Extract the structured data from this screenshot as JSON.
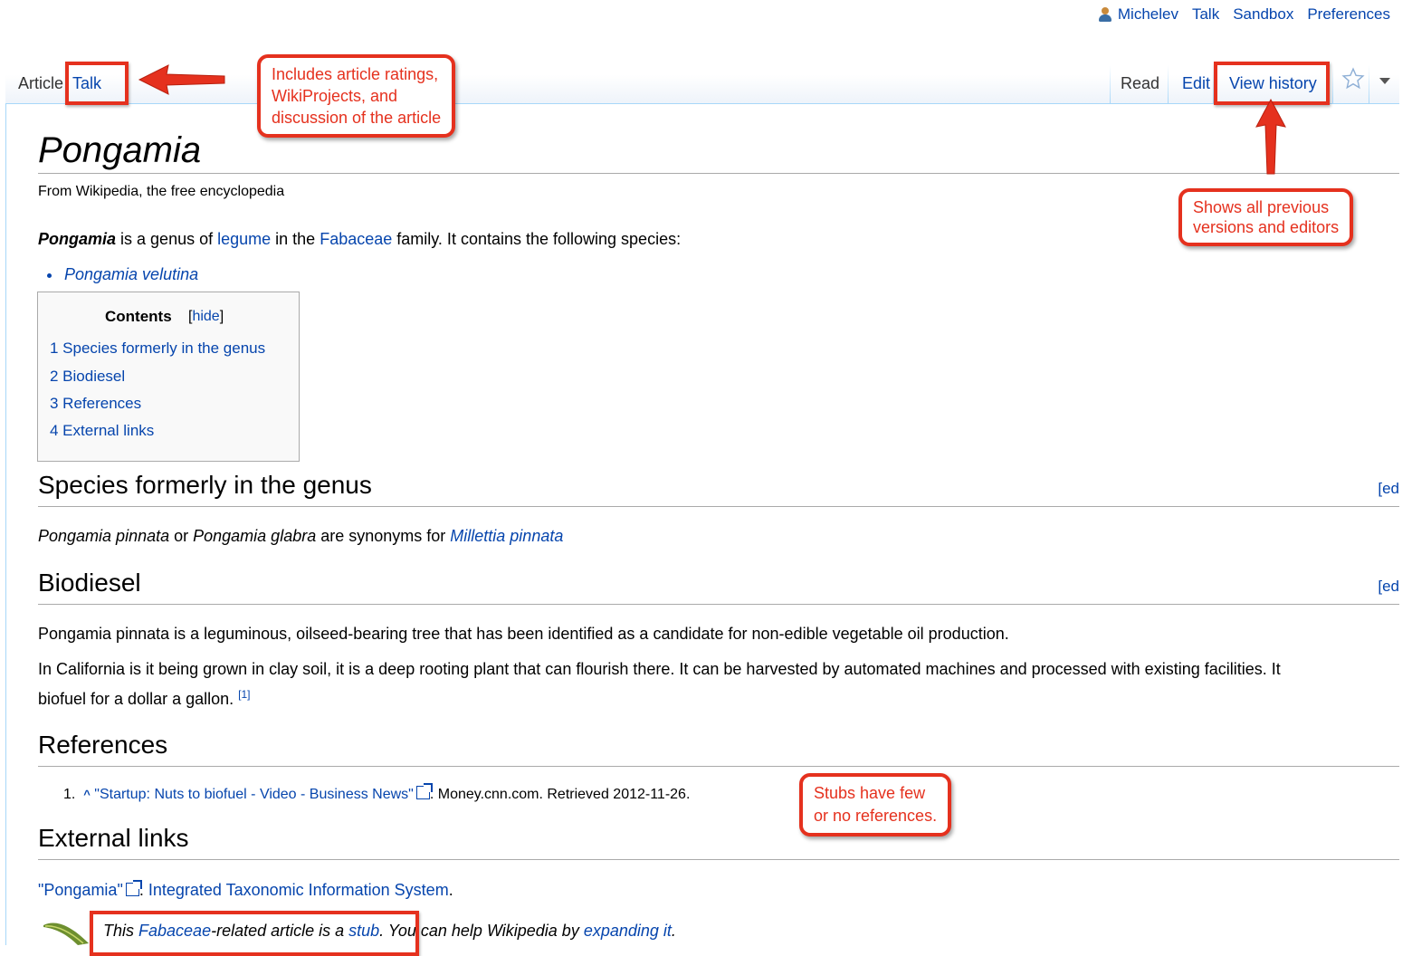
{
  "personal": {
    "username": "Michelev",
    "talk": "Talk",
    "sandbox": "Sandbox",
    "preferences": "Preferences",
    "user_icon": "user-icon"
  },
  "tabs": {
    "article": "Article",
    "talk": "Talk",
    "read": "Read",
    "edit": "Edit",
    "view_history": "View history",
    "watch_icon": "star-icon",
    "more_icon": "chevron-down-icon"
  },
  "page": {
    "title": "Pongamia",
    "tagline": "From Wikipedia, the free encyclopedia",
    "intro": {
      "bold": "Pongamia",
      "t1": " is a genus of ",
      "legume": "legume",
      "t2": " in the ",
      "fabaceae": "Fabaceae",
      "t3": " family. It contains the following species:"
    },
    "species": "Pongamia velutina"
  },
  "toc": {
    "title": "Contents",
    "hide_open": "[",
    "hide": "hide",
    "hide_close": "]",
    "items": [
      "1 Species formerly in the genus",
      "2 Biodiesel",
      "3 References",
      "4 External links"
    ]
  },
  "sections": {
    "species": {
      "heading": "Species formerly in the genus",
      "edit": "[ed",
      "p_a": "Pongamia pinnata",
      "p_b": " or ",
      "p_c": "Pongamia glabra",
      "p_d": " are synonyms for ",
      "p_link": "Millettia pinnata"
    },
    "biodiesel": {
      "heading": "Biodiesel",
      "edit": "[ed",
      "p1": "Pongamia pinnata is a leguminous, oilseed-bearing tree that has been identified as a candidate for non-edible vegetable oil production.",
      "p2": "In California is it being grown in clay soil, it is a deep rooting plant that can flourish there. It can be harvested by automated machines and processed with existing facilities. It",
      "p3": "biofuel for a dollar a gallon. ",
      "cite": "[1]"
    },
    "references": {
      "heading": "References",
      "num": "1.",
      "caret": "^",
      "link": "\"Startup: Nuts to biofuel - Video - Business News\"",
      "rest": ". Money.cnn.com. Retrieved 2012-11-26."
    },
    "external": {
      "heading": "External links",
      "link": "\"Pongamia\"",
      "sep": ". ",
      "source": "Integrated Taxonomic Information System",
      "end": "."
    }
  },
  "stub": {
    "t1": "This ",
    "fabaceae": "Fabaceae",
    "t2": "-related article is a ",
    "stub": "stub",
    "t3": ". You can help Wikipedia by ",
    "expand": "expanding it",
    "t4": "."
  },
  "annotations": {
    "talk_note": [
      "Includes article ratings,",
      "WikiProjects, and",
      "discussion of the article"
    ],
    "history_note": [
      "Shows all previous",
      "versions and editors"
    ],
    "stub_note": [
      "Stubs have few",
      "or no references."
    ]
  },
  "colors": {
    "annotation": "#e5311e",
    "link": "#0645ad",
    "tab_border": "#a7d7f9"
  }
}
